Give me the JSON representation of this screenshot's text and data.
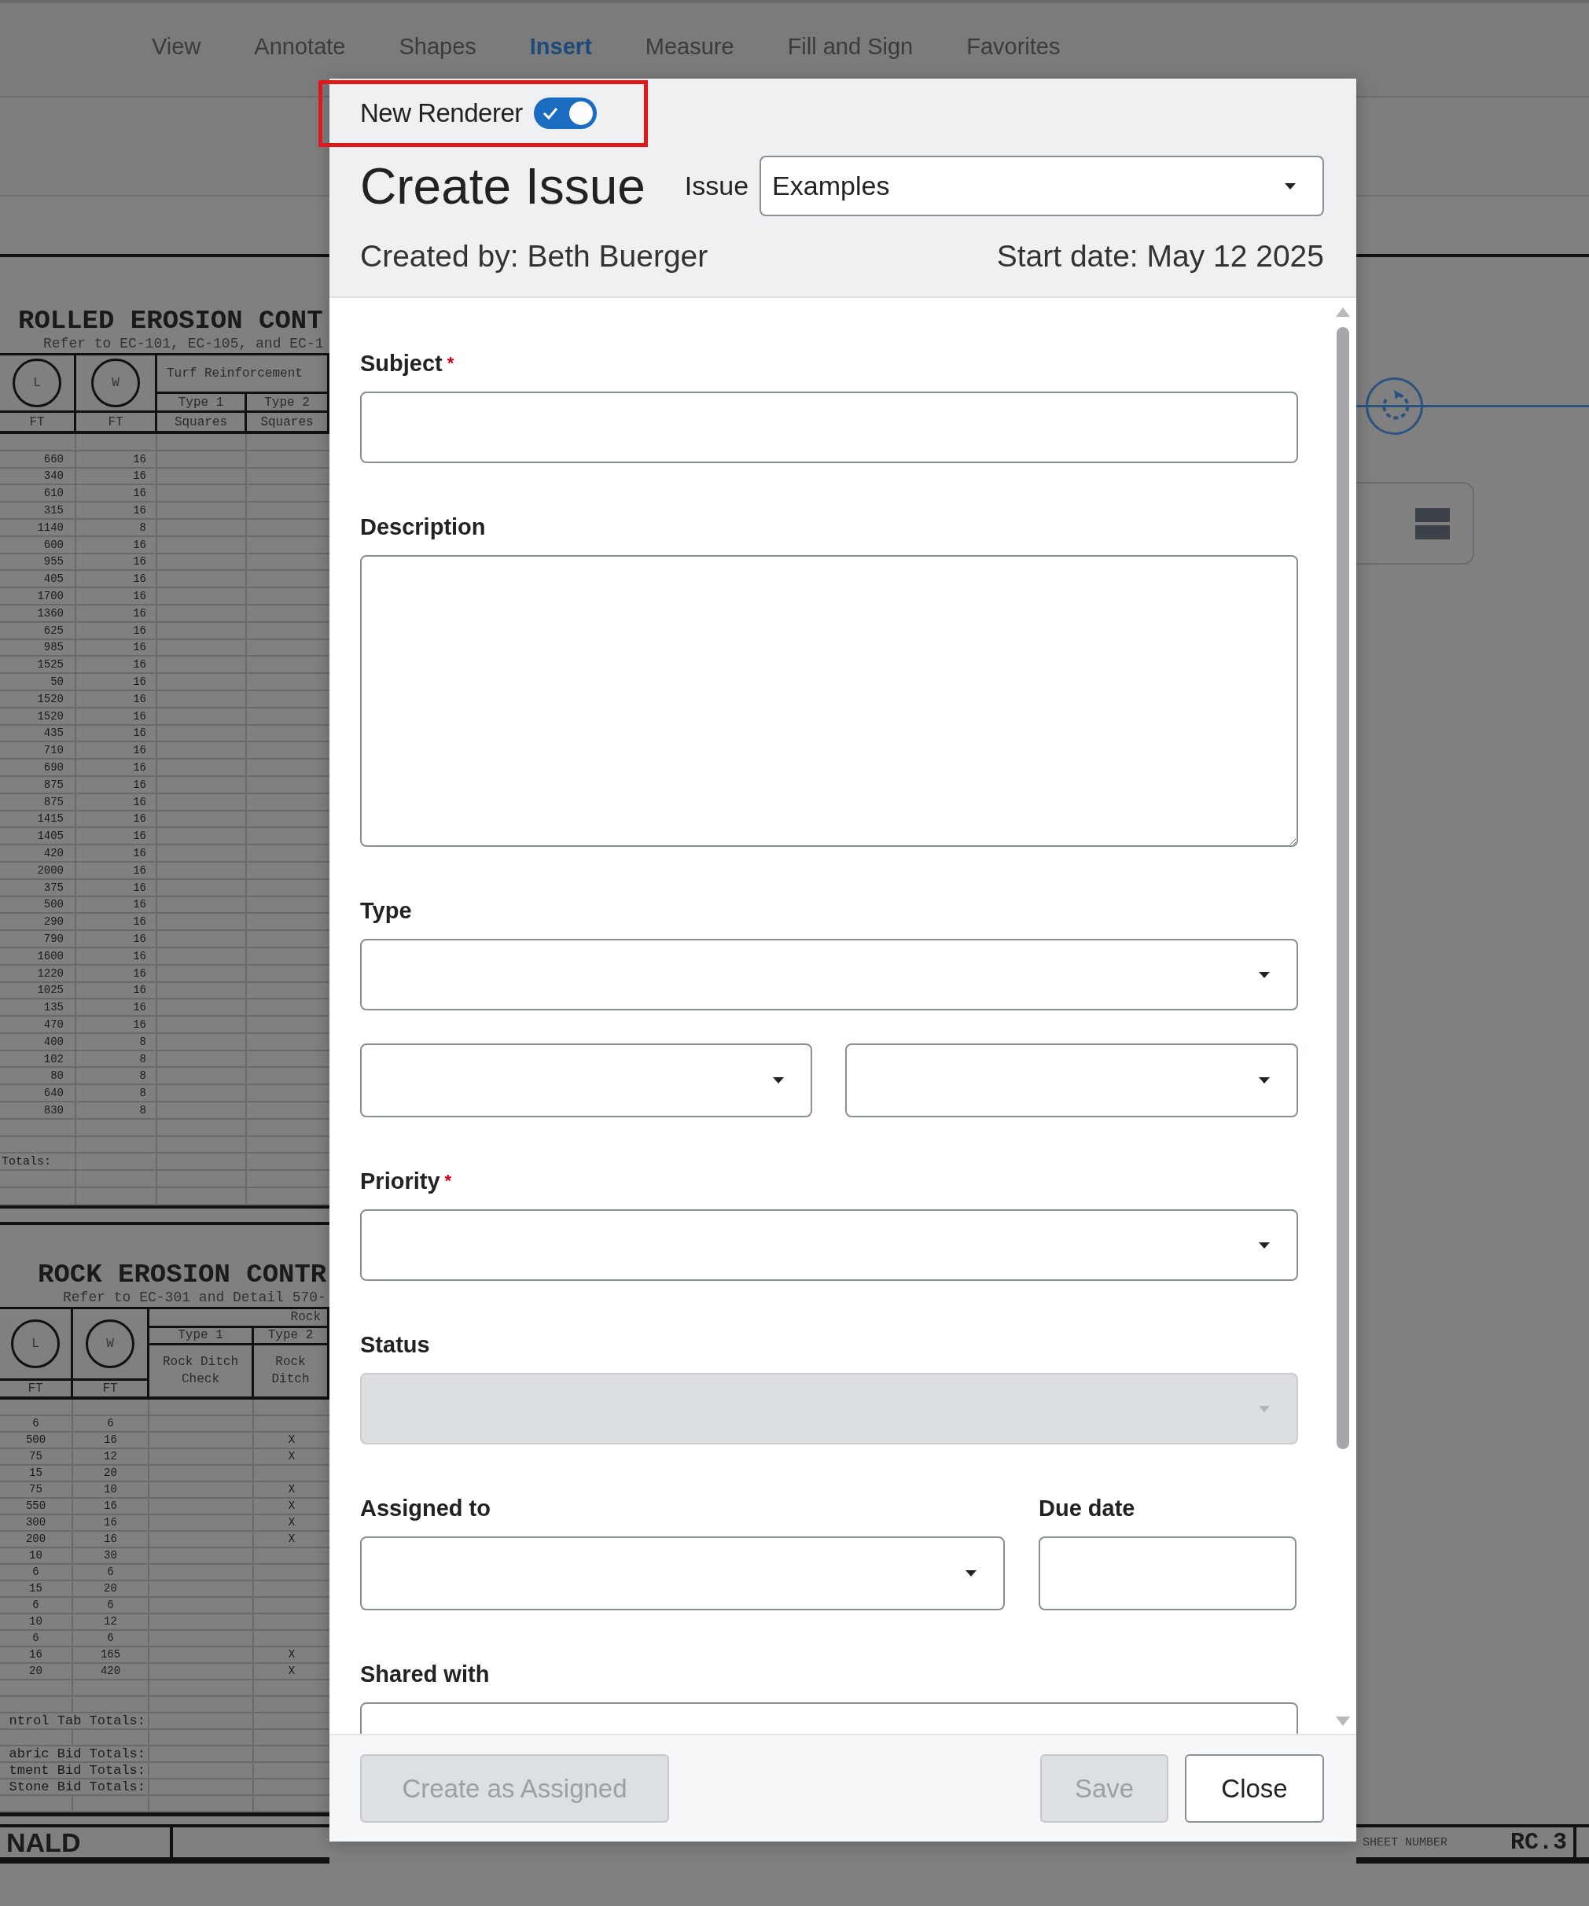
{
  "menu": [
    {
      "label": "View",
      "selected": false
    },
    {
      "label": "Annotate",
      "selected": false
    },
    {
      "label": "Shapes",
      "selected": false
    },
    {
      "label": "Insert",
      "selected": true
    },
    {
      "label": "Measure",
      "selected": false
    },
    {
      "label": "Fill and Sign",
      "selected": false
    },
    {
      "label": "Favorites",
      "selected": false
    }
  ],
  "drawing": {
    "rolled_table": {
      "title": "ROLLED EROSION CONT",
      "subtitle": "Refer to EC-101, EC-105, and EC-1",
      "header": {
        "col_1": "L",
        "col_2": "W",
        "group": "Turf Reinforcement",
        "type_1": "Type 1",
        "type_2": "Type 2",
        "unit_1": "FT",
        "unit_2": "FT",
        "unit_3": "Squares",
        "unit_4": "Squares"
      },
      "rows": [
        [
          "660",
          "16"
        ],
        [
          "340",
          "16"
        ],
        [
          "610",
          "16"
        ],
        [
          "315",
          "16"
        ],
        [
          "1140",
          "8"
        ],
        [
          "600",
          "16"
        ],
        [
          "955",
          "16"
        ],
        [
          "405",
          "16"
        ],
        [
          "1700",
          "16"
        ],
        [
          "1360",
          "16"
        ],
        [
          "625",
          "16"
        ],
        [
          "985",
          "16"
        ],
        [
          "1525",
          "16"
        ],
        [
          "50",
          "16"
        ],
        [
          "1520",
          "16"
        ],
        [
          "1520",
          "16"
        ],
        [
          "435",
          "16"
        ],
        [
          "710",
          "16"
        ],
        [
          "690",
          "16"
        ],
        [
          "875",
          "16"
        ],
        [
          "875",
          "16"
        ],
        [
          "1415",
          "16"
        ],
        [
          "1405",
          "16"
        ],
        [
          "420",
          "16"
        ],
        [
          "2000",
          "16"
        ],
        [
          "375",
          "16"
        ],
        [
          "500",
          "16"
        ],
        [
          "290",
          "16"
        ],
        [
          "790",
          "16"
        ],
        [
          "1600",
          "16"
        ],
        [
          "1220",
          "16"
        ],
        [
          "1025",
          "16"
        ],
        [
          "135",
          "16"
        ],
        [
          "470",
          "16"
        ],
        [
          "400",
          "8"
        ],
        [
          "102",
          "8"
        ],
        [
          "80",
          "8"
        ],
        [
          "640",
          "8"
        ],
        [
          "830",
          "8"
        ]
      ],
      "totals_label": "Totals:"
    },
    "rock_table": {
      "title": "ROCK EROSION CONTR",
      "subtitle": "Refer to EC-301 and Detail 570-",
      "header": {
        "col_1": "L",
        "col_2": "W",
        "group": "Rock",
        "type_1": "Type 1",
        "type_2": "Type 2",
        "item_1": "Rock Ditch Check",
        "item_2": "Rock Ditch",
        "unit_1": "FT",
        "unit_2": "FT"
      },
      "rows": [
        {
          "l": "6",
          "w": "6"
        },
        {
          "l": "500",
          "w": "16",
          "mark": "X"
        },
        {
          "l": "75",
          "w": "12",
          "mark": "X"
        },
        {
          "l": "15",
          "w": "20"
        },
        {
          "l": "75",
          "w": "10",
          "mark": "X"
        },
        {
          "l": "550",
          "w": "16",
          "mark": "X"
        },
        {
          "l": "300",
          "w": "16",
          "mark": "X"
        },
        {
          "l": "200",
          "w": "16",
          "mark": "X"
        },
        {
          "l": "10",
          "w": "30"
        },
        {
          "l": "6",
          "w": "6"
        },
        {
          "l": "15",
          "w": "20"
        },
        {
          "l": "6",
          "w": "6"
        },
        {
          "l": "10",
          "w": "12"
        },
        {
          "l": "6",
          "w": "6"
        },
        {
          "l": "16",
          "w": "165",
          "mark": "X"
        },
        {
          "l": "20",
          "w": "420",
          "mark": "X"
        }
      ],
      "totals": [
        "ntrol Tab Totals:",
        "abric Bid Totals:",
        "tment Bid Totals:",
        "Stone Bid Totals:"
      ]
    },
    "title_block": {
      "name": "NALD",
      "sheet_number_label": "SHEET NUMBER",
      "sheet_number": "RC.3"
    }
  },
  "dialog": {
    "renderer_toggle": {
      "label": "New Renderer",
      "on": true
    },
    "title": "Create Issue",
    "issue": {
      "label": "Issue",
      "value": "Examples"
    },
    "created_by": "Created by: Beth Buerger",
    "start_date": "Start date: May 12 2025",
    "fields": [
      {
        "kind": "text",
        "label": "Subject",
        "required_mark": "*",
        "disabled": false
      },
      {
        "kind": "textarea",
        "label": "Description",
        "disabled": false
      },
      {
        "kind": "select",
        "label": "Type",
        "disabled": false
      },
      {
        "kind": "select_pair",
        "disabled": false
      },
      {
        "kind": "select",
        "label": "Priority",
        "required_mark": "*",
        "disabled": false
      },
      {
        "kind": "select",
        "label": "Status",
        "disabled": true
      },
      {
        "kind": "assign_due",
        "label": "Assigned to",
        "label_2": "Due date",
        "disabled": false
      },
      {
        "kind": "text",
        "label": "Shared with",
        "disabled": false
      }
    ],
    "buttons": [
      {
        "label": "Create as Assigned",
        "disabled": true
      },
      {
        "label": "Save",
        "disabled": true
      },
      {
        "label": "Close",
        "disabled": false
      }
    ]
  }
}
